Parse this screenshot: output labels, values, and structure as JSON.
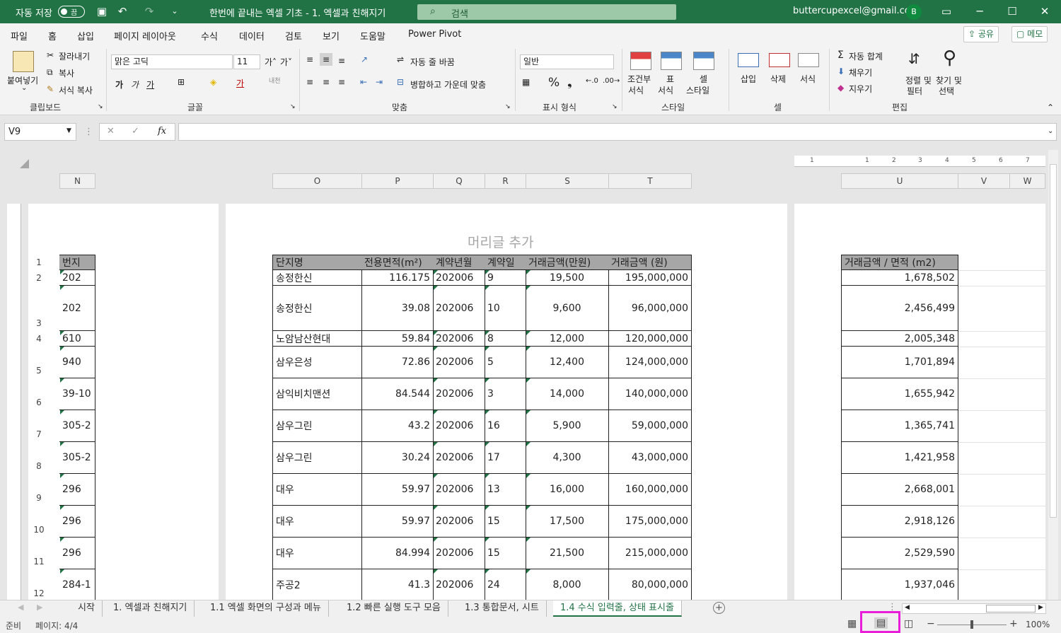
{
  "titlebar": {
    "autosave_label": "자동 저장",
    "autosave_state": "끔",
    "doc_title": "한번에 끝내는 엑셀 기초 - 1. 엑셀과 친해지기",
    "search_placeholder": "검색",
    "user_email": "buttercupexcel@gmail.com",
    "avatar_initial": "B"
  },
  "menu": {
    "items": [
      "파일",
      "홈",
      "삽입",
      "페이지 레이아웃",
      "수식",
      "데이터",
      "검토",
      "보기",
      "도움말",
      "Power Pivot"
    ],
    "share_label": "공유",
    "comment_label": "메모"
  },
  "ribbon": {
    "clipboard": {
      "paste": "붙여넣기",
      "cut": "잘라내기",
      "copy": "복사",
      "format_painter": "서식 복사",
      "group": "클립보드"
    },
    "font": {
      "name": "맑은 고딕",
      "size": "11",
      "bold": "가",
      "italic": "가",
      "underline": "가",
      "font_color": "가",
      "group": "글꼴"
    },
    "align": {
      "wrap": "자동 줄 바꿈",
      "merge": "병합하고 가운데 맞춤",
      "group": "맞춤"
    },
    "number": {
      "format": "일반",
      "group": "표시 형식"
    },
    "styles": {
      "conditional": "조건부",
      "conditional2": "서식",
      "table": "표",
      "table2": "서식",
      "cell": "셀",
      "cell2": "스타일",
      "group": "스타일"
    },
    "cells": {
      "insert": "삽입",
      "delete": "삭제",
      "format": "서식",
      "group": "셀"
    },
    "editing": {
      "autosum": "자동 합계",
      "fill": "채우기",
      "clear": "지우기",
      "sort": "정렬 및",
      "sort2": "필터",
      "find": "찾기 및",
      "find2": "선택",
      "group": "편집"
    }
  },
  "formula": {
    "name_box": "V9",
    "fx": "fx",
    "value": ""
  },
  "sheet": {
    "header_placeholder": "머리글 추가",
    "col_headers": [
      "N",
      "O",
      "P",
      "Q",
      "R",
      "S",
      "T",
      "U",
      "V",
      "W"
    ],
    "row_numbers": [
      "1",
      "2",
      "3",
      "4",
      "5",
      "6",
      "7",
      "8",
      "9",
      "10",
      "11",
      "12"
    ],
    "n_header": "번지",
    "main_headers": [
      "단지명",
      "전용면적(m²)",
      "계약년월",
      "계약일",
      "거래금액(만원)",
      "거래금액 (원)"
    ],
    "u_header": "거래금액 / 면적 (m2)",
    "rows": [
      {
        "n": "202",
        "name": "송정한신",
        "area": "116.175",
        "ym": "202006",
        "day": "9",
        "man": "19,500",
        "won": "195,000,000",
        "per": "1,678,502"
      },
      {
        "n": "202",
        "name": "송정한신",
        "area": "39.08",
        "ym": "202006",
        "day": "10",
        "man": "9,600",
        "won": "96,000,000",
        "per": "2,456,499"
      },
      {
        "n": "610",
        "name": "노암남산현대",
        "area": "59.84",
        "ym": "202006",
        "day": "8",
        "man": "12,000",
        "won": "120,000,000",
        "per": "2,005,348"
      },
      {
        "n": "940",
        "name": "삼우은성",
        "area": "72.86",
        "ym": "202006",
        "day": "5",
        "man": "12,400",
        "won": "124,000,000",
        "per": "1,701,894"
      },
      {
        "n": "39-10",
        "name": "삼익비치맨션",
        "area": "84.544",
        "ym": "202006",
        "day": "3",
        "man": "14,000",
        "won": "140,000,000",
        "per": "1,655,942"
      },
      {
        "n": "305-2",
        "name": "삼우그린",
        "area": "43.2",
        "ym": "202006",
        "day": "16",
        "man": "5,900",
        "won": "59,000,000",
        "per": "1,365,741"
      },
      {
        "n": "305-2",
        "name": "삼우그린",
        "area": "30.24",
        "ym": "202006",
        "day": "17",
        "man": "4,300",
        "won": "43,000,000",
        "per": "1,421,958"
      },
      {
        "n": "296",
        "name": "대우",
        "area": "59.97",
        "ym": "202006",
        "day": "13",
        "man": "16,000",
        "won": "160,000,000",
        "per": "2,668,001"
      },
      {
        "n": "296",
        "name": "대우",
        "area": "59.97",
        "ym": "202006",
        "day": "15",
        "man": "17,500",
        "won": "175,000,000",
        "per": "2,918,126"
      },
      {
        "n": "296",
        "name": "대우",
        "area": "84.994",
        "ym": "202006",
        "day": "15",
        "man": "21,500",
        "won": "215,000,000",
        "per": "2,529,590"
      },
      {
        "n": "284-1",
        "name": "주공2",
        "area": "41.3",
        "ym": "202006",
        "day": "24",
        "man": "8,000",
        "won": "80,000,000",
        "per": "1,937,046"
      }
    ]
  },
  "tabs": [
    "시작",
    "1. 엑셀과 친해지기",
    "1.1 엑셀 화면의 구성과 메뉴",
    "1.2 빠른 실행 도구 모음",
    "1.3 통합문서, 시트",
    "1.4 수식 입력줄, 상태 표시줄"
  ],
  "status": {
    "ready": "준비",
    "page": "페이지: 4/4",
    "zoom": "100%"
  },
  "colors": {
    "accent": "#217346",
    "highlight": "#e81ed8",
    "header_fill": "#a6a6a6"
  }
}
